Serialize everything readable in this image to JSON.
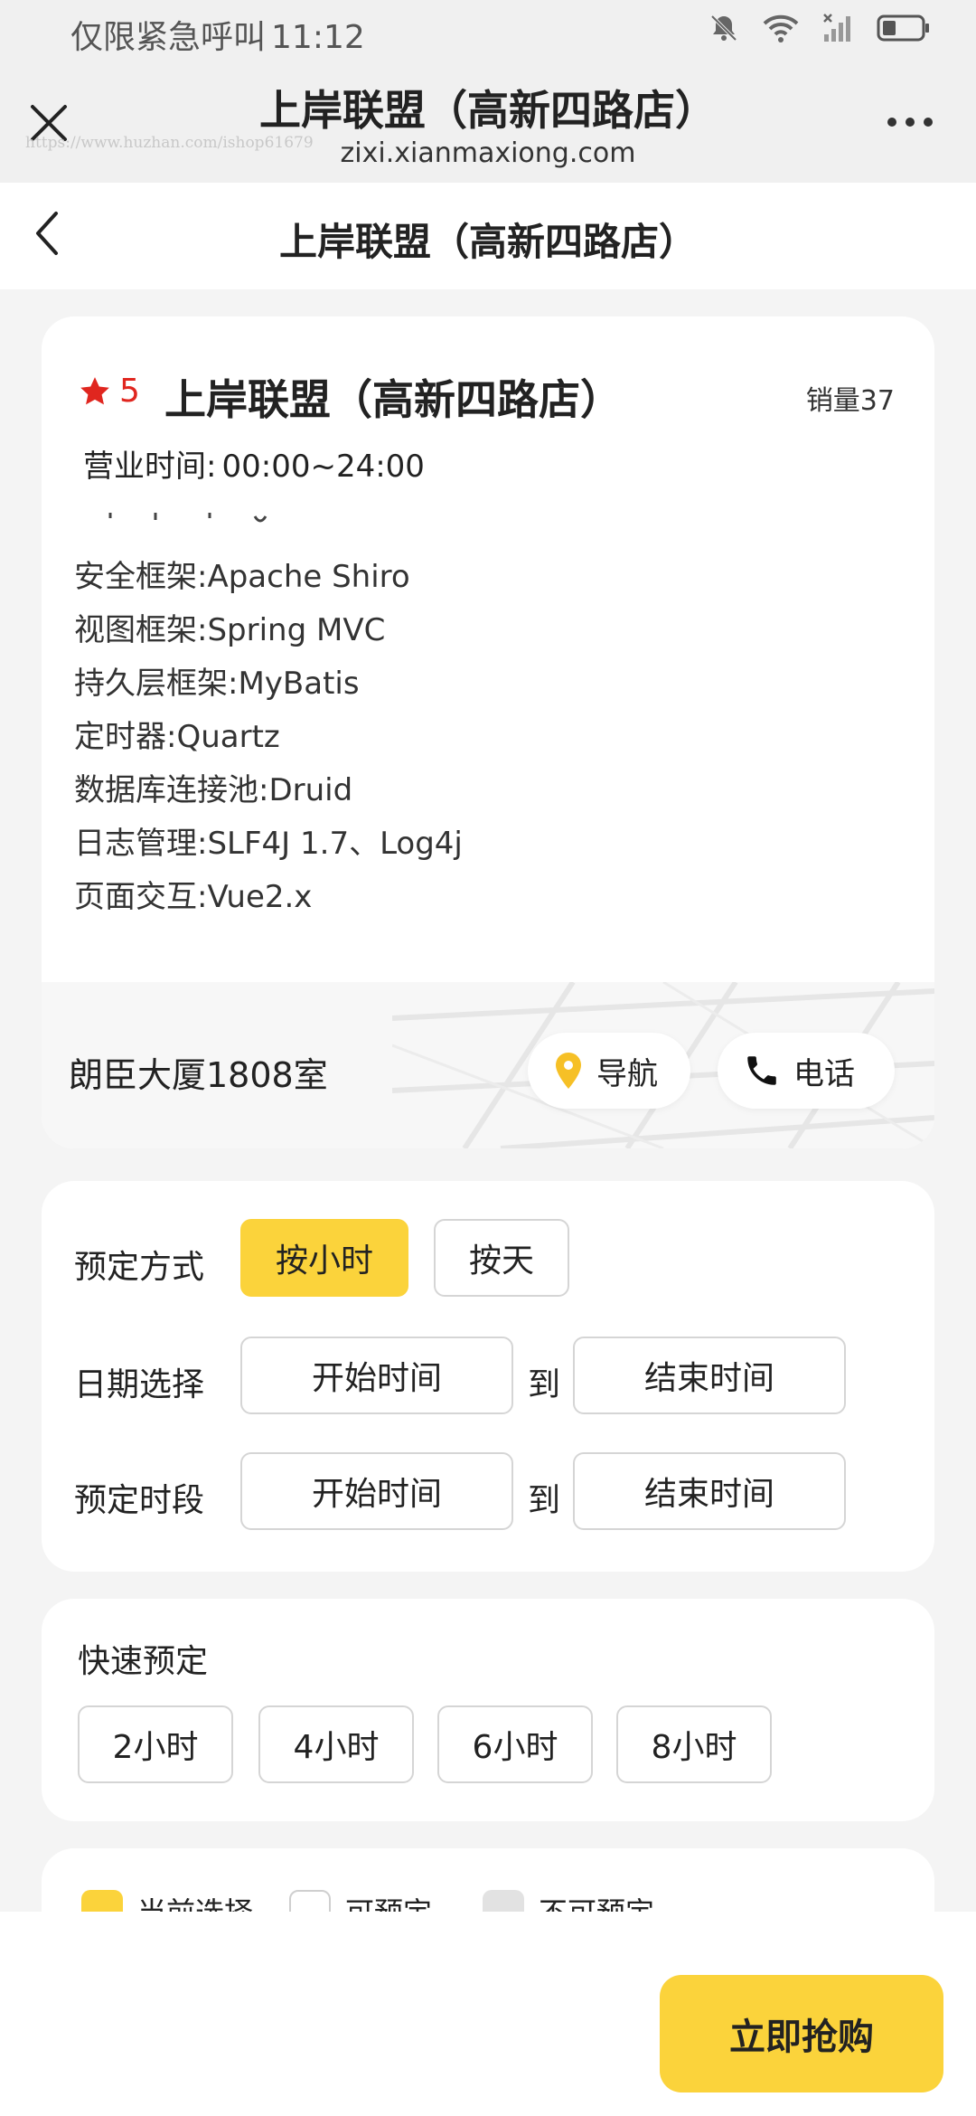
{
  "status_bar": {
    "carrier": "仅限紧急呼叫",
    "time": "11:12",
    "icons": [
      "bell-off-icon",
      "wifi-icon",
      "signal-icon",
      "battery-icon"
    ]
  },
  "browser": {
    "title": "上岸联盟（高新四路店）",
    "url": "zixi.xianmaxiong.com",
    "watermark": "https://www.huzhan.com/ishop61679"
  },
  "header": {
    "title": "上岸联盟（高新四路店）"
  },
  "shop": {
    "rating": "5",
    "name": "上岸联盟（高新四路店）",
    "sales": "销量37",
    "hours_label": "营业时间:",
    "hours_value": "00:00~24:00",
    "description_lines": [
      "安全框架:Apache Shiro",
      "视图框架:Spring MVC",
      "持久层框架:MyBatis",
      "定时器:Quartz",
      "数据库连接池:Druid",
      "日志管理:SLF4J 1.7、Log4j",
      "页面交互:Vue2.x"
    ],
    "address": "朗臣大厦1808室",
    "nav_label": "导航",
    "call_label": "电话"
  },
  "booking": {
    "mode_label": "预定方式",
    "mode_hour": "按小时",
    "mode_day": "按天",
    "date_label": "日期选择",
    "time_label": "预定时段",
    "start_placeholder": "开始时间",
    "end_placeholder": "结束时间",
    "to": "到"
  },
  "quick": {
    "title": "快速预定",
    "options": [
      "2小时",
      "4小时",
      "6小时",
      "8小时"
    ]
  },
  "legend": {
    "current": "当前选择",
    "available": "可预定",
    "unavailable": "不可预定"
  },
  "colors": {
    "accent": "#fbd33b",
    "star": "#e0261f",
    "nav_pin": "#f6c026"
  },
  "buy_label": "立即抢购"
}
